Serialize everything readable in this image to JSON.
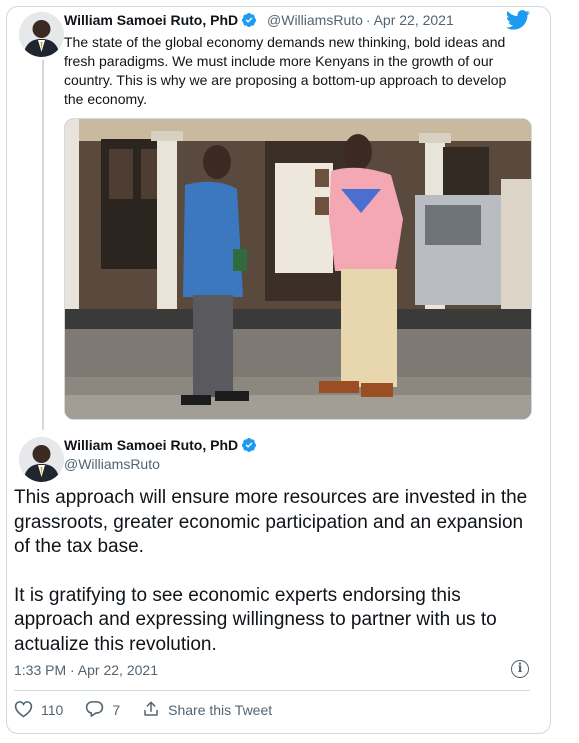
{
  "tweet1": {
    "author_name": "William Samoei Ruto, PhD",
    "author_handle": "@WilliamsRuto",
    "separator": "·",
    "date": "Apr 22, 2021",
    "text": "The state of the global economy demands new thinking, bold ideas and fresh paradigms. We must include more Kenyans in the growth of our country. This is why we are proposing a bottom-up approach to develop the economy."
  },
  "tweet2": {
    "author_name": "William Samoei Ruto, PhD",
    "author_handle": "@WilliamsRuto",
    "paragraph1": "This approach will ensure more resources are invested in the grassroots, greater economic participation and an expansion of the tax base.",
    "paragraph2": "It is gratifying to see economic experts endorsing this approach and expressing willingness to partner with us to actualize this revolution.",
    "timestamp": "1:33 PM · Apr 22, 2021"
  },
  "actions": {
    "likes": "110",
    "replies": "7",
    "share_label": "Share this Tweet"
  },
  "colors": {
    "brand_blue": "#1d9bf0",
    "text_primary": "#0f1419",
    "text_secondary": "#536471",
    "border": "#cfd9de"
  },
  "icons": [
    "twitter-bird-icon",
    "verified-badge-icon",
    "info-icon",
    "heart-icon",
    "reply-icon",
    "share-icon"
  ]
}
